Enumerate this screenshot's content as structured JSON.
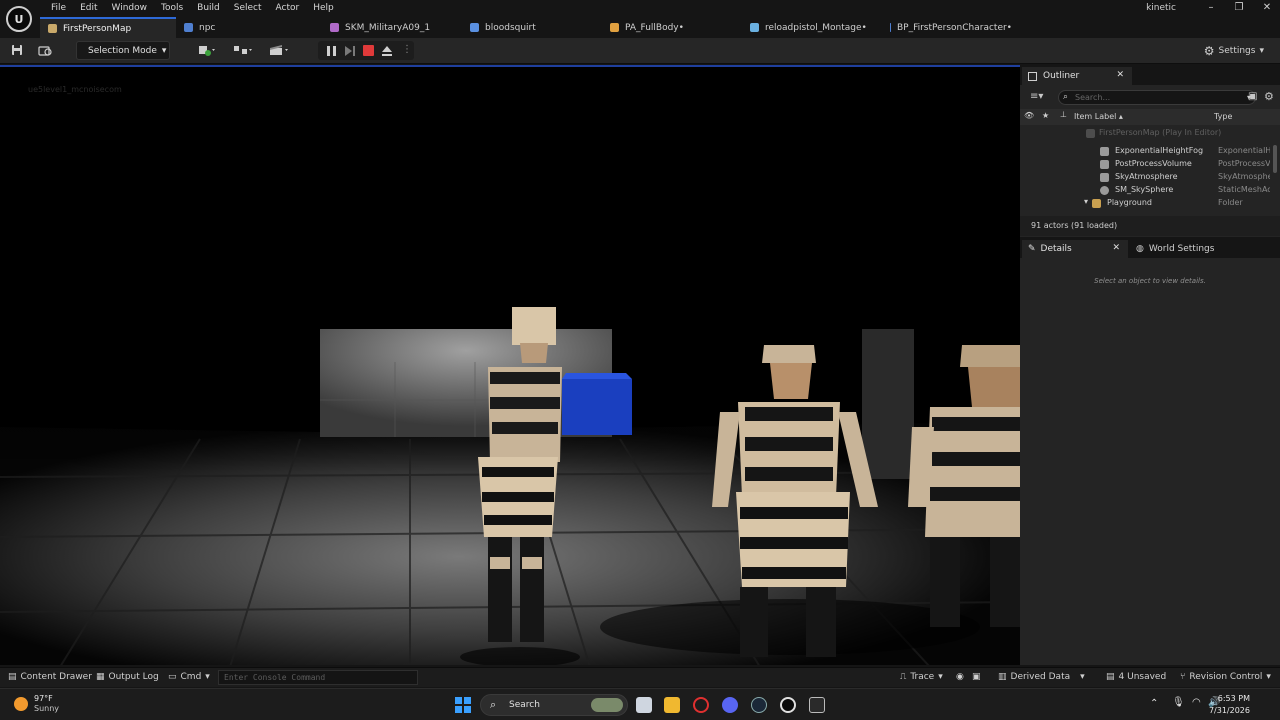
{
  "menu": [
    "File",
    "Edit",
    "Window",
    "Tools",
    "Build",
    "Select",
    "Actor",
    "Help"
  ],
  "tabs": [
    {
      "label": "FirstPersonMap",
      "icon": "level-icon",
      "active": true
    },
    {
      "label": "npc",
      "icon": "blueprint-icon"
    },
    {
      "label": "SKM_MilitaryA09_1",
      "icon": "skeletal-mesh-icon"
    },
    {
      "label": "bloodsquirt",
      "icon": "niagara-icon"
    },
    {
      "label": "PA_FullBody•",
      "icon": "physics-asset-icon"
    },
    {
      "label": "reloadpistol_Montage•",
      "icon": "montage-icon"
    },
    {
      "label": "BP_FirstPersonCharacter•",
      "icon": "blueprint-icon"
    }
  ],
  "user": "kinetic",
  "toolbar": {
    "selection_mode": "Selection Mode",
    "settings": "Settings"
  },
  "viewport": {
    "label": "ue5level1_mcnoisecom"
  },
  "outliner": {
    "title": "Outliner",
    "search_placeholder": "Search...",
    "columns": {
      "label": "Item Label ▴",
      "type": "Type"
    },
    "root": "FirstPersonMap (Play In Editor)",
    "rows": [
      {
        "label": "ExponentialHeightFog",
        "type": "ExponentialHe"
      },
      {
        "label": "PostProcessVolume",
        "type": "PostProcessV"
      },
      {
        "label": "SkyAtmosphere",
        "type": "SkyAtmosphe"
      },
      {
        "label": "SM_SkySphere",
        "type": "StaticMeshAc"
      },
      {
        "label": "Playground",
        "type": "Folder"
      }
    ],
    "actor_count": "91 actors (91 loaded)"
  },
  "details": {
    "title": "Details",
    "world_settings": "World Settings",
    "empty_message": "Select an object to view details."
  },
  "statusbar": {
    "content_drawer": "Content Drawer",
    "output_log": "Output Log",
    "cmd": "Cmd",
    "console_placeholder": "Enter Console Command",
    "trace": "Trace",
    "derived_data": "Derived Data",
    "unsaved": "4 Unsaved",
    "revision_control": "Revision Control"
  },
  "taskbar": {
    "temperature": "97°F",
    "condition": "Sunny",
    "search": "Search",
    "time": "6:53 PM",
    "date": "7/31/2026"
  },
  "colors": {
    "accent": "#2e6ad8",
    "record": "#e03a3a",
    "viewport_border": "#1f3f9e",
    "cube": "#1a3fbf"
  }
}
